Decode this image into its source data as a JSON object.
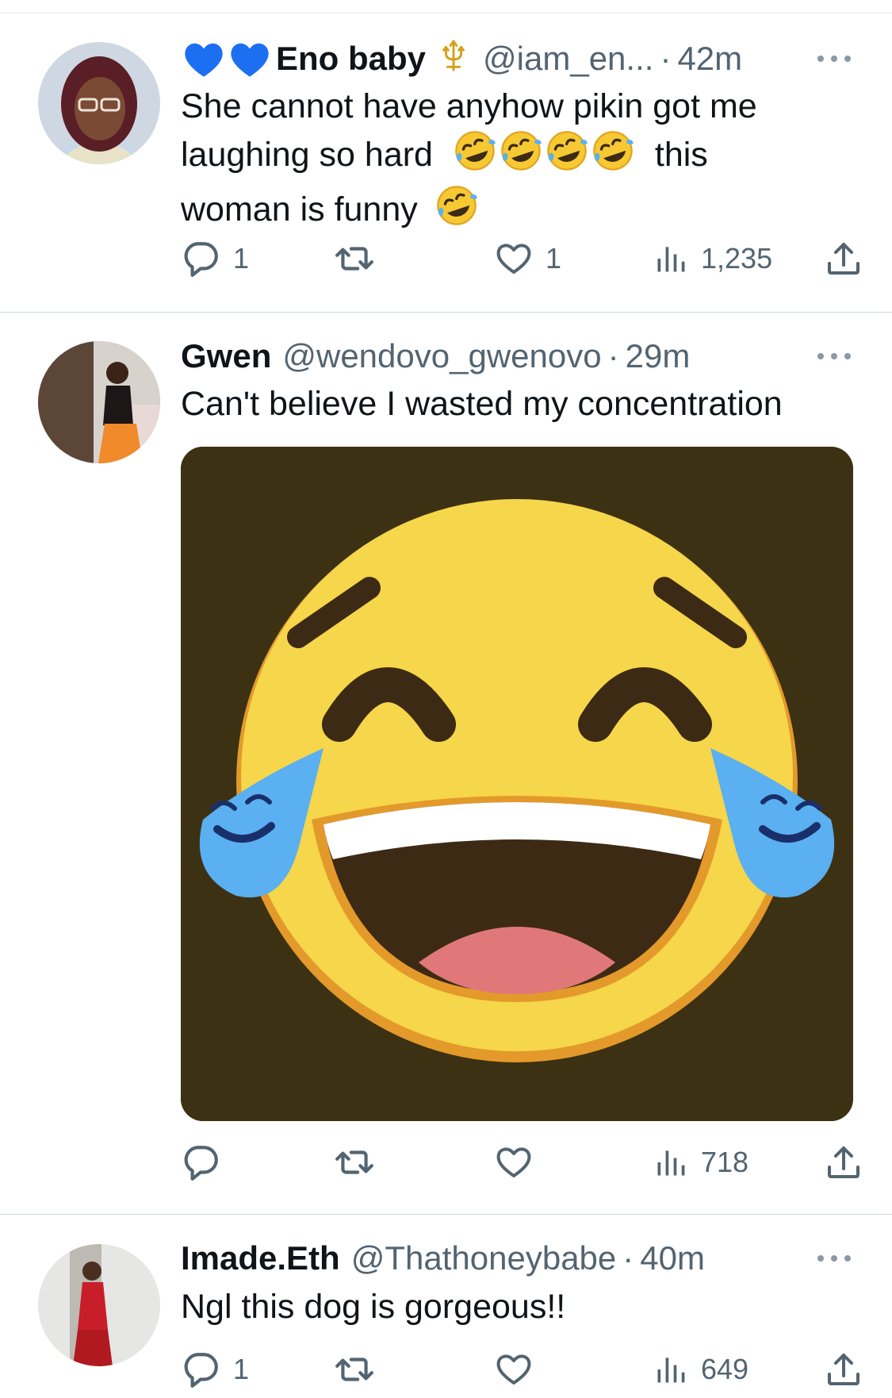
{
  "tweets": [
    {
      "name": "Eno baby",
      "handle": "@iam_en...",
      "separator": "·",
      "time": "42m",
      "text_line1": "She cannot have anyhow pikin got me",
      "text_line2a": "laughing so hard",
      "text_line2b": "this",
      "text_line3": "woman is funny",
      "replies": "1",
      "retweets": "",
      "likes": "1",
      "views": "1,235"
    },
    {
      "name": "Gwen",
      "handle": "@wendovo_gwenovo",
      "separator": "·",
      "time": "29m",
      "text": "Can't believe I wasted my concentration",
      "replies": "",
      "retweets": "",
      "likes": "",
      "views": "718"
    },
    {
      "name": "Imade.Eth",
      "handle": "@Thathoneybabe",
      "separator": "·",
      "time": "40m",
      "text": "Ngl this dog is gorgeous!!",
      "replies": "1",
      "retweets": "",
      "likes": "",
      "views": "649"
    }
  ],
  "icons": {
    "reply": "reply-icon",
    "retweet": "retweet-icon",
    "like": "heart-icon",
    "views": "views-icon",
    "share": "share-icon",
    "more": "more-icon"
  },
  "colors": {
    "text": "#0f1419",
    "secondary": "#536471",
    "heart_badge": "#1d6ff2",
    "media_bg": "#3d3114",
    "emoji_face": "#f6d64a"
  }
}
